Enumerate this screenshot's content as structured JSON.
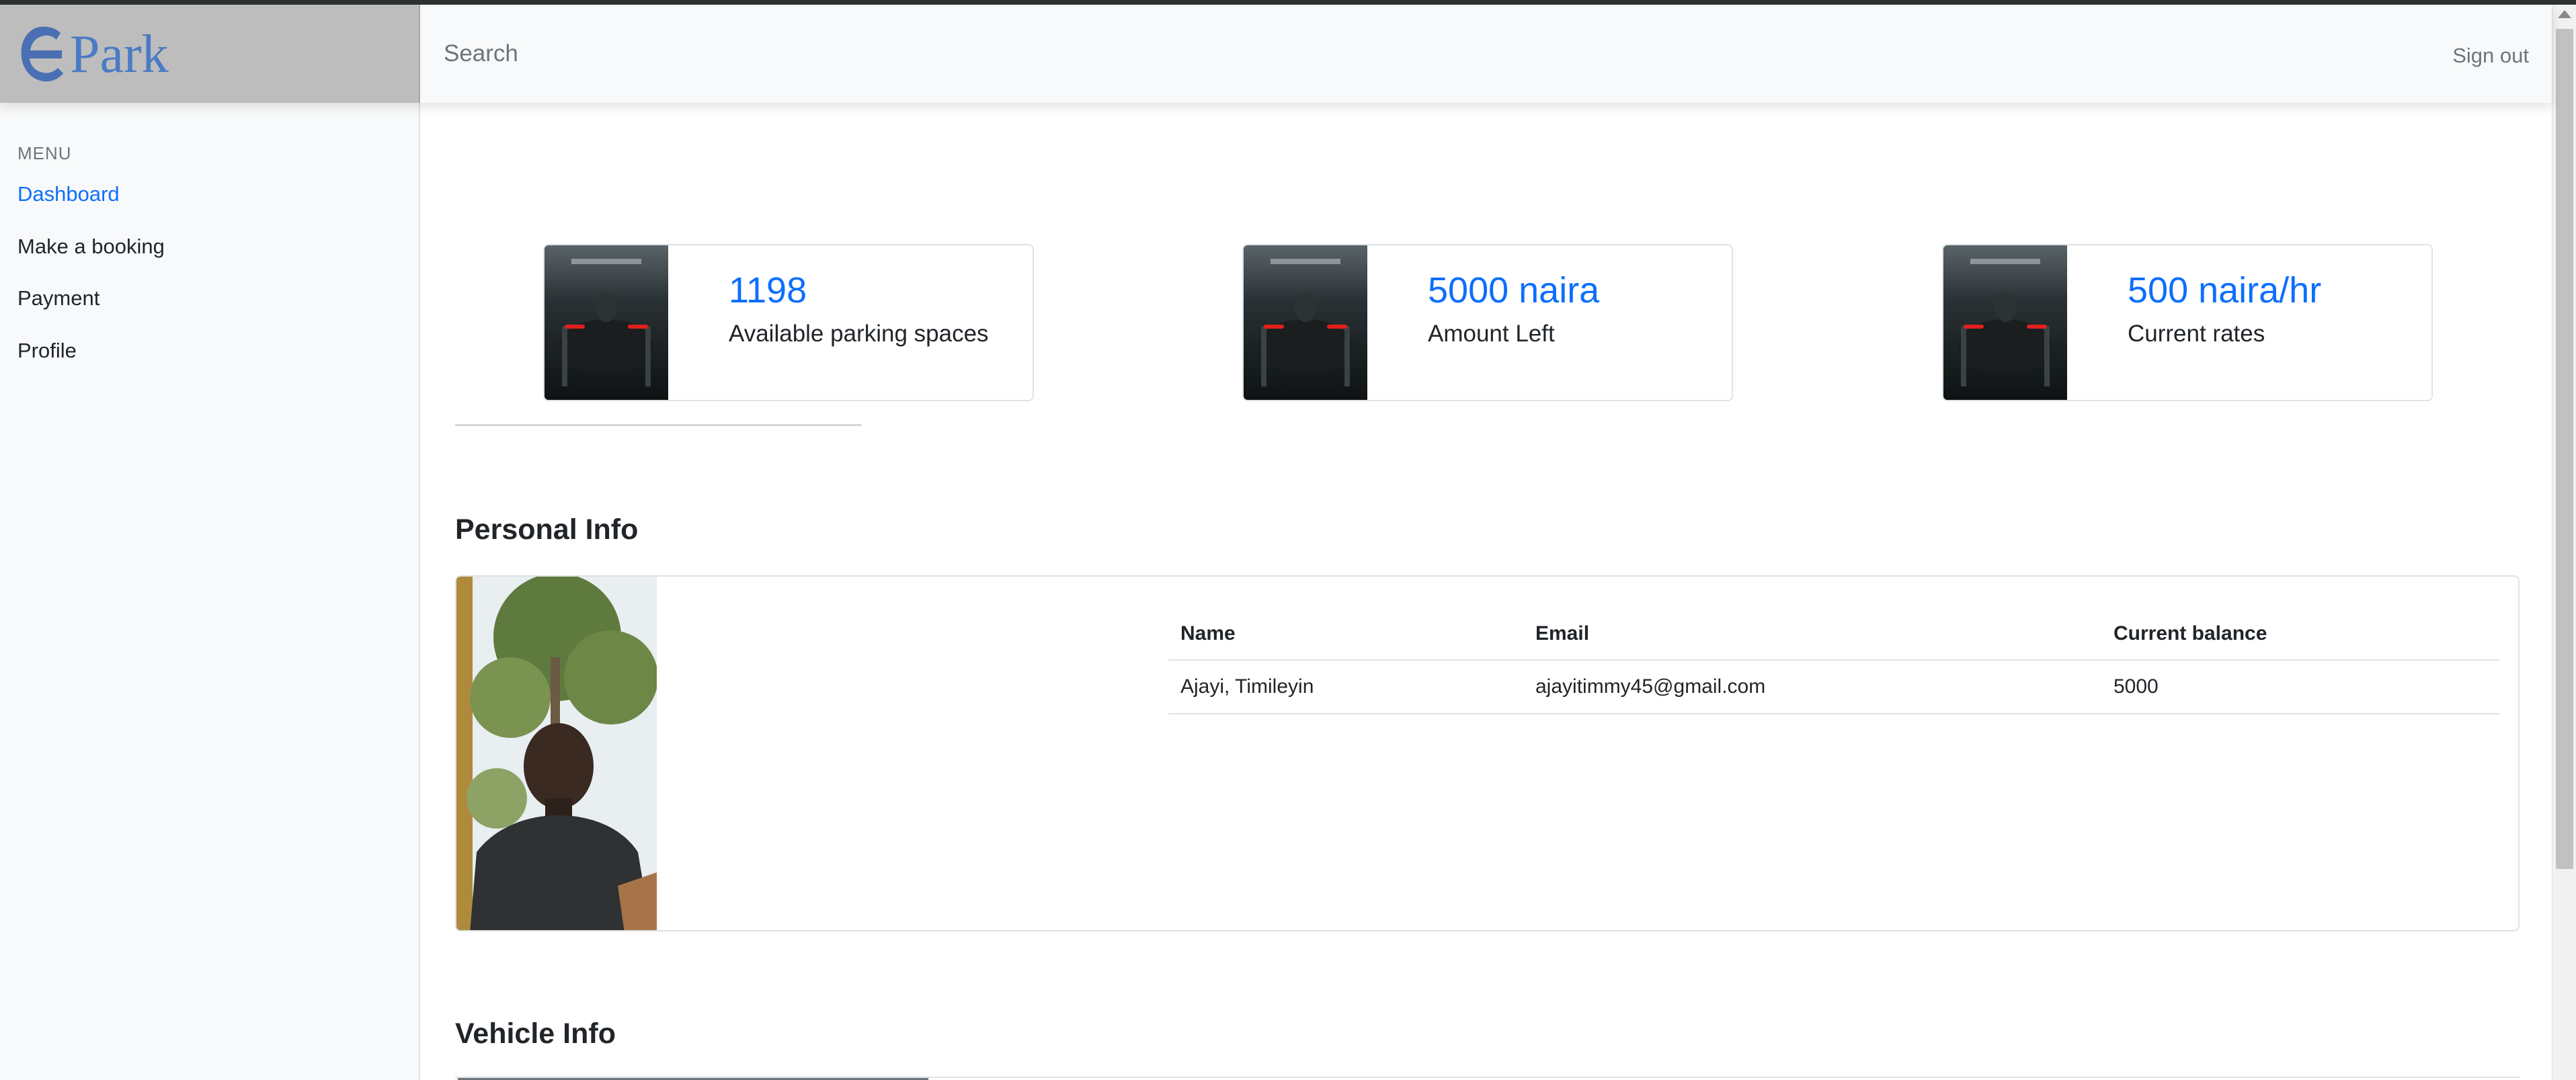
{
  "app": {
    "brand_text": "Park"
  },
  "header": {
    "search_placeholder": "Search",
    "signout_label": "Sign out"
  },
  "sidebar": {
    "heading": "MENU",
    "items": [
      {
        "label": "Dashboard",
        "active": true
      },
      {
        "label": "Make a booking",
        "active": false
      },
      {
        "label": "Payment",
        "active": false
      },
      {
        "label": "Profile",
        "active": false
      }
    ]
  },
  "stats": [
    {
      "value": "1198",
      "label": "Available parking spaces"
    },
    {
      "value": "5000 naira",
      "label": "Amount Left"
    },
    {
      "value": "500 naira/hr",
      "label": "Current rates"
    }
  ],
  "personal_info": {
    "title": "Personal Info",
    "columns": [
      "Name",
      "Email",
      "Current balance"
    ],
    "rows": [
      [
        "Ajayi, Timileyin",
        "ajayitimmy45@gmail.com",
        "5000"
      ]
    ]
  },
  "vehicle_info": {
    "title": "Vehicle Info"
  },
  "colors": {
    "accent": "#0d6efd",
    "brand": "#4a7bc4",
    "brand_bg": "#bdbdbd",
    "sidebar_bg": "#f8f9fa"
  }
}
